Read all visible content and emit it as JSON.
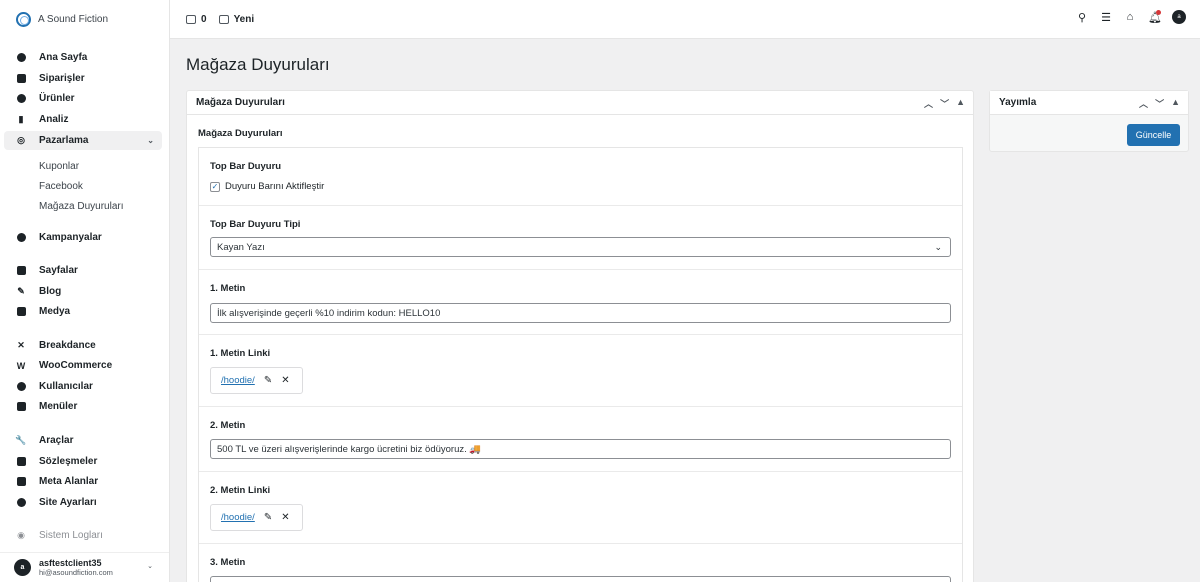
{
  "brand": {
    "name": "A Sound Fiction"
  },
  "sidebar": {
    "items": [
      {
        "label": "Ana Sayfa",
        "icon": "home-icon"
      },
      {
        "label": "Siparişler",
        "icon": "orders-icon"
      },
      {
        "label": "Ürünler",
        "icon": "tag-icon"
      },
      {
        "label": "Analiz",
        "icon": "chart-icon"
      },
      {
        "label": "Pazarlama",
        "icon": "marketing-icon"
      },
      {
        "label": "Kampanyalar",
        "icon": "campaign-icon"
      },
      {
        "label": "Sayfalar",
        "icon": "pages-icon"
      },
      {
        "label": "Blog",
        "icon": "pen-icon"
      },
      {
        "label": "Medya",
        "icon": "media-icon"
      },
      {
        "label": "Breakdance",
        "icon": "breakdance-icon"
      },
      {
        "label": "WooCommerce",
        "icon": "woo-icon"
      },
      {
        "label": "Kullanıcılar",
        "icon": "users-icon"
      },
      {
        "label": "Menüler",
        "icon": "menus-icon"
      },
      {
        "label": "Araçlar",
        "icon": "wrench-icon"
      },
      {
        "label": "Sözleşmeler",
        "icon": "contracts-icon"
      },
      {
        "label": "Meta Alanlar",
        "icon": "meta-icon"
      },
      {
        "label": "Site Ayarları",
        "icon": "settings-icon"
      },
      {
        "label": "Sistem Logları",
        "icon": "logs-icon"
      }
    ],
    "submenu": [
      "Kuponlar",
      "Facebook",
      "Mağaza Duyuruları"
    ],
    "expand_glyph": "⌄"
  },
  "user": {
    "name": "asftestclient35",
    "email": "hi@asoundfiction.com",
    "initial": "a"
  },
  "topbar": {
    "comments_count": "0",
    "new_label": "Yeni",
    "avatar_initial": "a"
  },
  "page": {
    "title": "Mağaza Duyuruları"
  },
  "main_box": {
    "title": "Mağaza Duyuruları",
    "section": "Mağaza Duyuruları",
    "fields": {
      "top_bar": {
        "label": "Top Bar Duyuru",
        "checkbox_label": "Duyuru Barını Aktifleştir",
        "checked": true
      },
      "type": {
        "label": "Top Bar Duyuru Tipi",
        "value": "Kayan Yazı"
      },
      "text1": {
        "label": "1. Metin",
        "value": "İlk alışverişinde geçerli %10 indirim kodun: HELLO10"
      },
      "link1": {
        "label": "1. Metin Linki",
        "value": "/hoodie/"
      },
      "text2": {
        "label": "2. Metin",
        "value": "500 TL ve üzeri alışverişlerinde kargo ücretini biz ödüyoruz. 🚚"
      },
      "link2": {
        "label": "2. Metin Linki",
        "value": "/hoodie/"
      },
      "text3": {
        "label": "3. Metin",
        "value": ""
      }
    }
  },
  "side_box": {
    "title": "Yayımla",
    "button": "Güncelle"
  }
}
